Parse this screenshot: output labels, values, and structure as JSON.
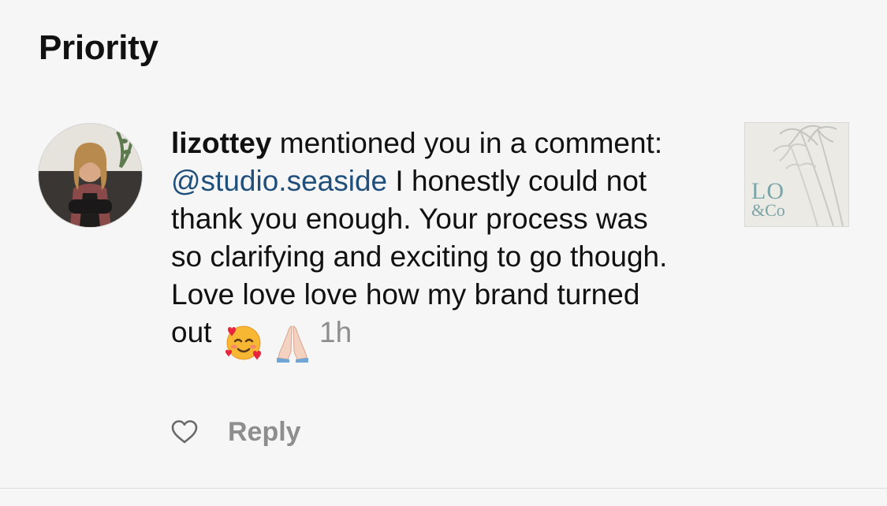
{
  "section": {
    "title": "Priority"
  },
  "notification": {
    "username": "lizottey",
    "action_text": " mentioned you in a comment: ",
    "mention": "@studio.seaside",
    "comment_text": " I honestly could not thank you enough. Your process was so clarifying and exciting to go though. Love love love how my brand turned out",
    "emojis": [
      "smiling-face-with-hearts",
      "folded-hands"
    ],
    "timestamp": "1h",
    "avatar_icon": "user-profile-photo",
    "thumbnail": {
      "logo_text_top": "LO",
      "logo_text_bottom": "&Co",
      "icon": "palm-tree-logo-thumbnail"
    },
    "actions": {
      "like_icon": "heart-outline-icon",
      "reply_label": "Reply"
    }
  },
  "colors": {
    "background": "#f6f6f6",
    "text": "#111111",
    "mention": "#1f4f7a",
    "muted": "#8e8e8e",
    "logo": "#7aa5a8"
  }
}
